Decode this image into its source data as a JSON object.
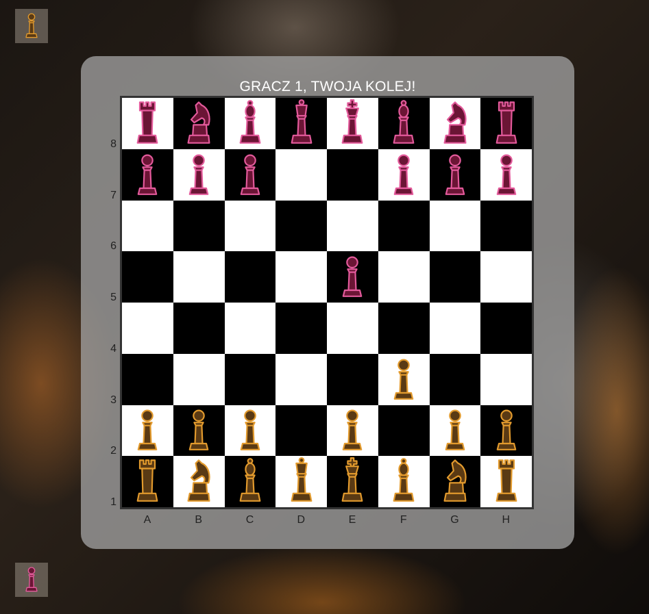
{
  "status": {
    "message": "GRACZ 1, TWOJA KOLEJ!"
  },
  "colors": {
    "player1_fill": "#5a3a14",
    "player1_stroke": "#e29a2d",
    "player2_fill": "#6b1535",
    "player2_stroke": "#e35a9b",
    "light_square": "#ffffff",
    "dark_square": "#000000"
  },
  "indicators": {
    "top": {
      "player": 1,
      "piece": "pawn"
    },
    "bottom": {
      "player": 2,
      "piece": "pawn"
    }
  },
  "board": {
    "files": [
      "A",
      "B",
      "C",
      "D",
      "E",
      "F",
      "G",
      "H"
    ],
    "ranks": [
      "8",
      "7",
      "6",
      "5",
      "4",
      "3",
      "2",
      "1"
    ],
    "rows": [
      [
        [
          "p2",
          "rook"
        ],
        [
          "p2",
          "knight"
        ],
        [
          "p2",
          "bishop"
        ],
        [
          "p2",
          "queen"
        ],
        [
          "p2",
          "king"
        ],
        [
          "p2",
          "bishop"
        ],
        [
          "p2",
          "knight"
        ],
        [
          "p2",
          "rook"
        ]
      ],
      [
        [
          "p2",
          "pawn"
        ],
        [
          "p2",
          "pawn"
        ],
        [
          "p2",
          "pawn"
        ],
        null,
        null,
        [
          "p2",
          "pawn"
        ],
        [
          "p2",
          "pawn"
        ],
        [
          "p2",
          "pawn"
        ]
      ],
      [
        null,
        null,
        null,
        null,
        null,
        null,
        null,
        null
      ],
      [
        null,
        null,
        null,
        null,
        [
          "p2",
          "pawn"
        ],
        null,
        null,
        null
      ],
      [
        null,
        null,
        null,
        null,
        null,
        null,
        null,
        null
      ],
      [
        null,
        null,
        null,
        null,
        null,
        [
          "p1",
          "pawn"
        ],
        null,
        null
      ],
      [
        [
          "p1",
          "pawn"
        ],
        [
          "p1",
          "pawn"
        ],
        [
          "p1",
          "pawn"
        ],
        null,
        [
          "p1",
          "pawn"
        ],
        null,
        [
          "p1",
          "pawn"
        ],
        [
          "p1",
          "pawn"
        ]
      ],
      [
        [
          "p1",
          "rook"
        ],
        [
          "p1",
          "knight"
        ],
        [
          "p1",
          "bishop"
        ],
        [
          "p1",
          "queen"
        ],
        [
          "p1",
          "king"
        ],
        [
          "p1",
          "bishop"
        ],
        [
          "p1",
          "knight"
        ],
        [
          "p1",
          "rook"
        ]
      ]
    ]
  }
}
